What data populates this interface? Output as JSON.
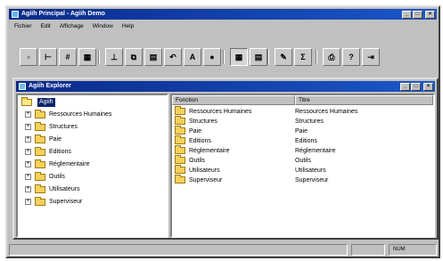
{
  "window": {
    "title": "Agiih Principal - Agiih Demo"
  },
  "menu": [
    "Fichier",
    "Edit",
    "Affichage",
    "Window",
    "Help"
  ],
  "toolbar": [
    {
      "icon": "view-small-icon",
      "glyph": "▫"
    },
    {
      "icon": "tree-icon",
      "glyph": "⊢"
    },
    {
      "icon": "grid-icon",
      "glyph": "#"
    },
    {
      "icon": "table-icon",
      "glyph": "▦"
    },
    {
      "icon": "pin-icon",
      "glyph": "⊥"
    },
    {
      "icon": "copy-icon",
      "glyph": "⧉"
    },
    {
      "icon": "print-preview-icon",
      "glyph": "▤"
    },
    {
      "icon": "undo-icon",
      "glyph": "↶"
    },
    {
      "icon": "font-icon",
      "glyph": "A"
    },
    {
      "icon": "color-icon",
      "glyph": "●"
    },
    {
      "icon": "grid-view-icon",
      "glyph": "▦"
    },
    {
      "icon": "report-icon",
      "glyph": "▤"
    },
    {
      "icon": "edit-icon",
      "glyph": "✎"
    },
    {
      "icon": "sum-icon",
      "glyph": "Σ"
    },
    {
      "icon": "printer-icon",
      "glyph": "⎙"
    },
    {
      "icon": "help-icon",
      "glyph": "?"
    },
    {
      "icon": "exit-icon",
      "glyph": "⇥"
    }
  ],
  "explorer": {
    "title": "Agiih Explorer",
    "root": "Agiih",
    "tree": [
      "Ressources Humaines",
      "Structures",
      "Paie",
      "Editions",
      "Réglementaire",
      "Outils",
      "Utilisateurs",
      "Superviseur"
    ],
    "columns": [
      "Fonction",
      "Titre"
    ],
    "rows": [
      [
        "Ressources Humaines",
        "Ressources Humaines"
      ],
      [
        "Structures",
        "Structures"
      ],
      [
        "Paie",
        "Paie"
      ],
      [
        "Editions",
        "Editions"
      ],
      [
        "Réglementaire",
        "Réglementaire"
      ],
      [
        "Outils",
        "Outils"
      ],
      [
        "Utilisateurs",
        "Utilisateurs"
      ],
      [
        "Superviseur",
        "Superviseur"
      ]
    ]
  },
  "status": {
    "indicator": "NUM"
  },
  "colors": {
    "titlebar": "#0a2a8a",
    "selection": "#0a246a",
    "folder": "#f5d15a"
  }
}
